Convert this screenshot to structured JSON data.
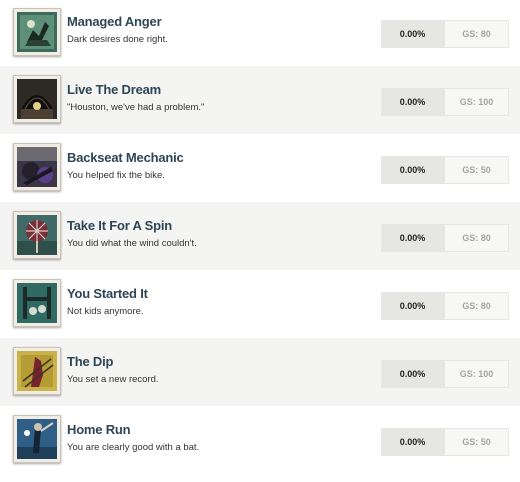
{
  "achievements": [
    {
      "title": "Managed Anger",
      "description": "Dark desires done right.",
      "percent": "0.00%",
      "gamerscore": "GS: 80",
      "icon": "managed-anger-icon"
    },
    {
      "title": "Live The Dream",
      "description": "\"Houston, we've had a problem.\"",
      "percent": "0.00%",
      "gamerscore": "GS: 100",
      "icon": "live-the-dream-icon"
    },
    {
      "title": "Backseat Mechanic",
      "description": "You helped fix the bike.",
      "percent": "0.00%",
      "gamerscore": "GS: 50",
      "icon": "backseat-mechanic-icon"
    },
    {
      "title": "Take It For A Spin",
      "description": "You did what the wind couldn't.",
      "percent": "0.00%",
      "gamerscore": "GS: 80",
      "icon": "take-it-for-a-spin-icon"
    },
    {
      "title": "You Started It",
      "description": "Not kids anymore.",
      "percent": "0.00%",
      "gamerscore": "GS: 80",
      "icon": "you-started-it-icon"
    },
    {
      "title": "The Dip",
      "description": "You set a new record.",
      "percent": "0.00%",
      "gamerscore": "GS: 100",
      "icon": "the-dip-icon"
    },
    {
      "title": "Home Run",
      "description": "You are clearly good with a bat.",
      "percent": "0.00%",
      "gamerscore": "GS: 50",
      "icon": "home-run-icon"
    }
  ],
  "colors": {
    "title": "#2f4656",
    "row_alt_bg": "#f4f4f2",
    "percent_bg": "#e6e6e3",
    "gamerscore_text": "#a5a5a5"
  }
}
